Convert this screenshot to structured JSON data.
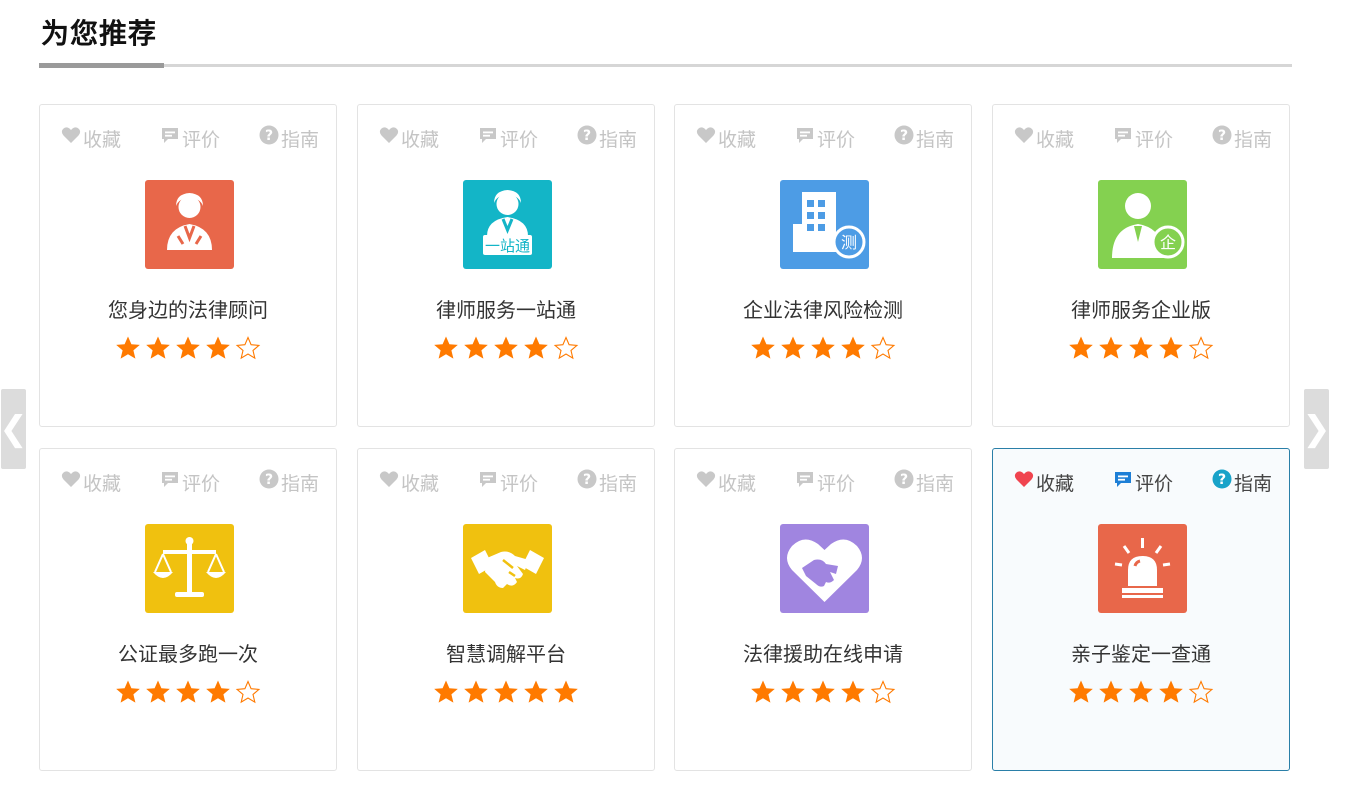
{
  "section": {
    "title": "为您推荐"
  },
  "nav": {
    "prev_label": "❮",
    "next_label": "❯"
  },
  "action_labels": {
    "favorite": "收藏",
    "review": "评价",
    "guide": "指南"
  },
  "colors": {
    "star": "#ff7a00",
    "inactive_action": "#c8c8c8",
    "active_fav": "#f0444f",
    "active_review": "#1e7fd6",
    "active_guide": "#19a3c9",
    "active_border": "#2a7fa8"
  },
  "cards": [
    {
      "title": "您身边的法律顾问",
      "rating": 4,
      "icon": "lawyer-icon",
      "icon_color": "#e8674a",
      "active": false
    },
    {
      "title": "律师服务一站通",
      "rating": 4,
      "icon": "lawyer-onestop-icon",
      "icon_color": "#13b5c7",
      "icon_text": "一站通",
      "active": false
    },
    {
      "title": "企业法律风险检测",
      "rating": 4,
      "icon": "building-check-icon",
      "icon_color": "#4d9ce5",
      "icon_text": "测",
      "active": false
    },
    {
      "title": "律师服务企业版",
      "rating": 4,
      "icon": "business-person-icon",
      "icon_color": "#84d150",
      "icon_text": "企",
      "active": false
    },
    {
      "title": "公证最多跑一次",
      "rating": 4,
      "icon": "scales-icon",
      "icon_color": "#f0c10f",
      "active": false
    },
    {
      "title": "智慧调解平台",
      "rating": 5,
      "icon": "handshake-icon",
      "icon_color": "#f0c10f",
      "active": false
    },
    {
      "title": "法律援助在线申请",
      "rating": 4,
      "icon": "heart-handshake-icon",
      "icon_color": "#a085e0",
      "active": false
    },
    {
      "title": "亲子鉴定一查通",
      "rating": 4,
      "icon": "alarm-light-icon",
      "icon_color": "#e8674a",
      "active": true
    }
  ]
}
